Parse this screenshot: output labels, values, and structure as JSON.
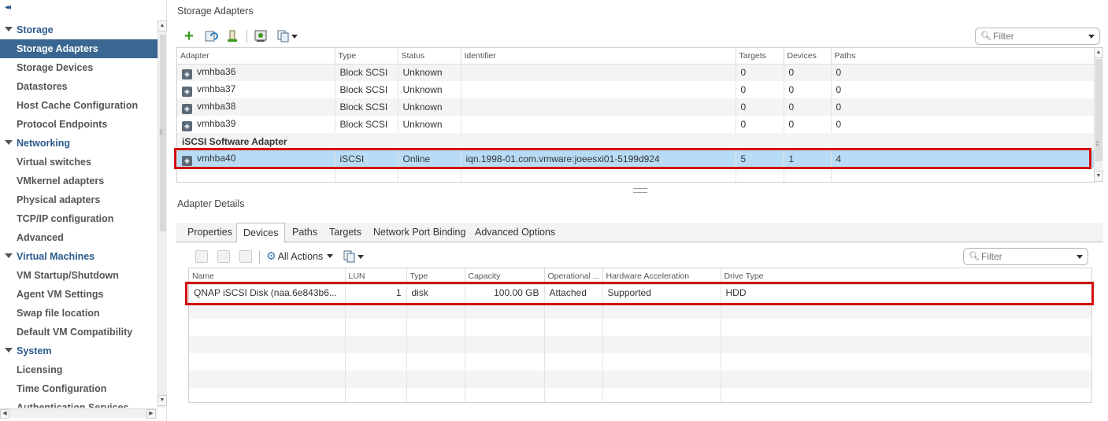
{
  "nav": {
    "collapse_glyph": "◂◂",
    "items": [
      {
        "label": "Storage",
        "kind": "section"
      },
      {
        "label": "Storage Adapters",
        "kind": "selected"
      },
      {
        "label": "Storage Devices",
        "kind": "sub"
      },
      {
        "label": "Datastores",
        "kind": "sub"
      },
      {
        "label": "Host Cache Configuration",
        "kind": "sub"
      },
      {
        "label": "Protocol Endpoints",
        "kind": "sub"
      },
      {
        "label": "Networking",
        "kind": "section"
      },
      {
        "label": "Virtual switches",
        "kind": "sub"
      },
      {
        "label": "VMkernel adapters",
        "kind": "sub"
      },
      {
        "label": "Physical adapters",
        "kind": "sub"
      },
      {
        "label": "TCP/IP configuration",
        "kind": "sub"
      },
      {
        "label": "Advanced",
        "kind": "sub"
      },
      {
        "label": "Virtual Machines",
        "kind": "section"
      },
      {
        "label": "VM Startup/Shutdown",
        "kind": "sub"
      },
      {
        "label": "Agent VM Settings",
        "kind": "sub"
      },
      {
        "label": "Swap file location",
        "kind": "sub"
      },
      {
        "label": "Default VM Compatibility",
        "kind": "sub"
      },
      {
        "label": "System",
        "kind": "section"
      },
      {
        "label": "Licensing",
        "kind": "sub"
      },
      {
        "label": "Time Configuration",
        "kind": "sub"
      },
      {
        "label": "Authentication Services",
        "kind": "sub"
      }
    ]
  },
  "storage_adapters": {
    "title": "Storage Adapters",
    "toolbar_icons": [
      "add-icon",
      "rescan-icon",
      "rescan-vmfs-icon",
      "refresh-adapter-icon",
      "copy-icon"
    ],
    "filter_placeholder": "Filter",
    "columns": [
      "Adapter",
      "Type",
      "Status",
      "Identifier",
      "Targets",
      "Devices",
      "Paths"
    ],
    "rows": [
      {
        "adapter": "vmhba36",
        "type": "Block SCSI",
        "status": "Unknown",
        "identifier": "",
        "targets": "0",
        "devices": "0",
        "paths": "0"
      },
      {
        "adapter": "vmhba37",
        "type": "Block SCSI",
        "status": "Unknown",
        "identifier": "",
        "targets": "0",
        "devices": "0",
        "paths": "0"
      },
      {
        "adapter": "vmhba38",
        "type": "Block SCSI",
        "status": "Unknown",
        "identifier": "",
        "targets": "0",
        "devices": "0",
        "paths": "0"
      },
      {
        "adapter": "vmhba39",
        "type": "Block SCSI",
        "status": "Unknown",
        "identifier": "",
        "targets": "0",
        "devices": "0",
        "paths": "0"
      }
    ],
    "group_label": "iSCSI Software Adapter",
    "selected_row": {
      "adapter": "vmhba40",
      "type": "iSCSI",
      "status": "Online",
      "identifier": "iqn.1998-01.com.vmware:joeesxi01-5199d924",
      "targets": "5",
      "devices": "1",
      "paths": "4"
    }
  },
  "adapter_details": {
    "title": "Adapter Details",
    "tabs": [
      "Properties",
      "Devices",
      "Paths",
      "Targets",
      "Network Port Binding",
      "Advanced Options"
    ],
    "active_tab": "Devices",
    "all_actions_label": "All Actions",
    "filter_placeholder": "Filter",
    "columns": [
      "Name",
      "LUN",
      "Type",
      "Capacity",
      "Operational ...",
      "Hardware Acceleration",
      "Drive Type"
    ],
    "rows": [
      {
        "name": "QNAP iSCSI Disk (naa.6e843b6...",
        "lun": "1",
        "type": "disk",
        "capacity": "100.00 GB",
        "operational": "Attached",
        "hw_accel": "Supported",
        "drive_type": "HDD"
      }
    ]
  },
  "colors": {
    "accent": "#3a6791",
    "selection": "#b8dcf5",
    "highlight": "#d40f0f",
    "add_green": "#3a9a1c"
  }
}
